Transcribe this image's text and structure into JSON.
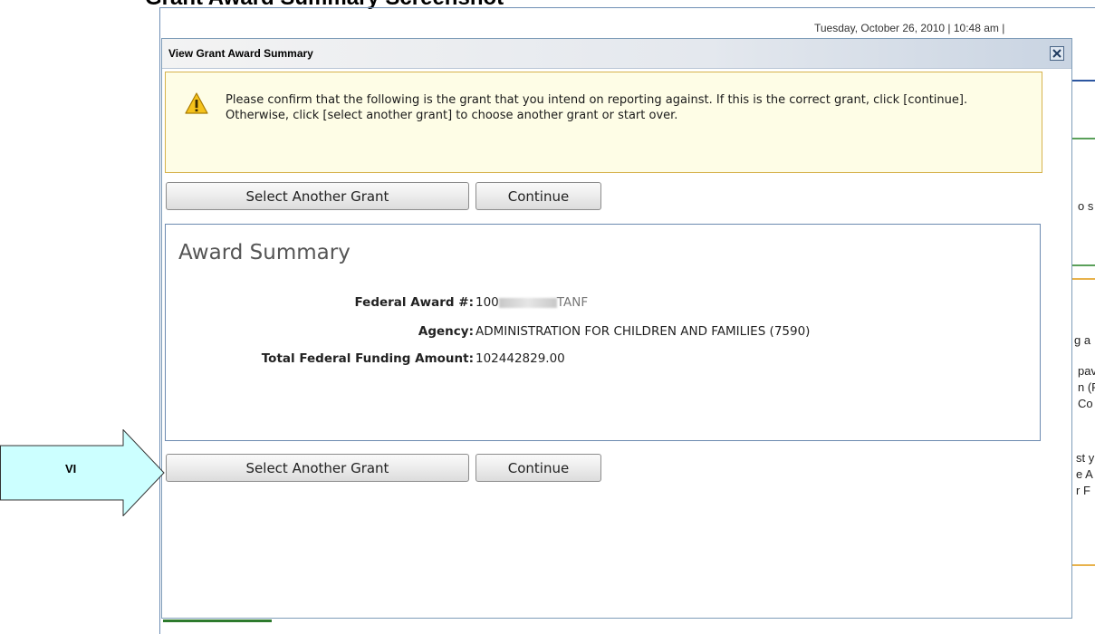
{
  "background": {
    "heading": "Grant Award Summary Screenshot",
    "datetime": "Tuesday, October 26, 2010 | 10:48 am |",
    "right_fragments": [
      "o s",
      "g a",
      "pav",
      "n (F",
      " Co",
      "st y",
      "e A",
      "r F"
    ]
  },
  "dialog": {
    "title": "View Grant Award Summary",
    "close_icon": "close-icon",
    "warning": {
      "icon": "warning-icon",
      "text": "Please confirm that the following is the grant that you intend on reporting against. If this is the correct grant, click [continue]. Otherwise, click [select another grant] to choose another grant or start over."
    },
    "top_buttons": {
      "select_another": "Select Another Grant",
      "continue": "Continue"
    },
    "award_summary": {
      "heading": "Award Summary",
      "rows": [
        {
          "label": "Federal Award #:",
          "value": "100",
          "value_suffix": "TANF"
        },
        {
          "label": "Agency:",
          "value": "ADMINISTRATION FOR CHILDREN AND FAMILIES (7590)"
        },
        {
          "label": "Total Federal Funding Amount:",
          "value": "102442829.00"
        }
      ]
    },
    "bottom_buttons": {
      "select_another": "Select Another Grant",
      "continue": "Continue"
    }
  },
  "callout": {
    "label": "VI",
    "color": "#ccffff"
  },
  "colors": {
    "warning_bg": "#fefde6",
    "warning_border": "#d6b24c",
    "panel_border": "#6c8ab0",
    "dialog_border": "#7f9db9"
  }
}
